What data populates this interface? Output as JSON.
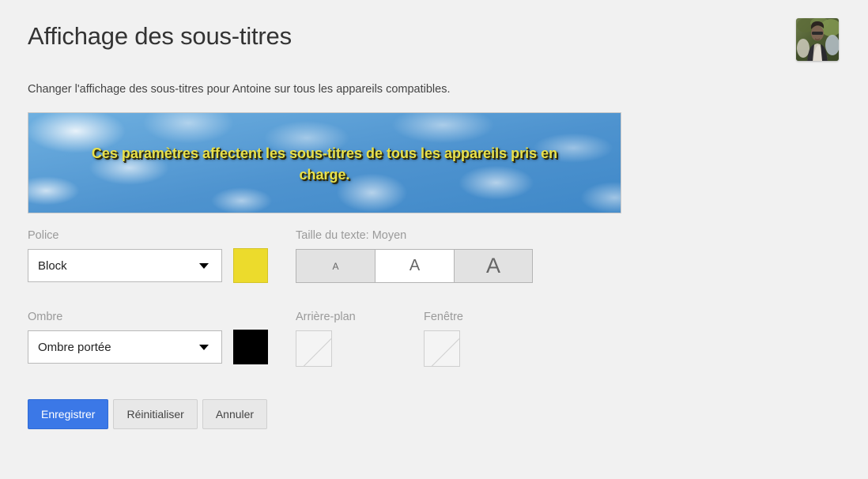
{
  "header": {
    "title": "Affichage des sous-titres",
    "subtitle": "Changer l'affichage des sous-titres pour Antoine sur tous les appareils compatibles.",
    "avatar_alt": "avatar"
  },
  "preview": {
    "caption_text": "Ces paramètres affectent les sous-titres de tous les appareils pris en charge.",
    "text_color": "#e9e14a",
    "shadow_color": "#2a2a12",
    "sky_color": "#5ba0d8"
  },
  "form": {
    "font": {
      "label": "Police",
      "value": "Block",
      "color": "#ecdb2c"
    },
    "text_size": {
      "label": "Taille du texte: Moyen",
      "options": [
        {
          "glyph": "A",
          "size": "small",
          "selected": false
        },
        {
          "glyph": "A",
          "size": "medium",
          "selected": true
        },
        {
          "glyph": "A",
          "size": "large",
          "selected": false
        }
      ]
    },
    "shadow": {
      "label": "Ombre",
      "value": "Ombre portée",
      "color": "#000000"
    },
    "background": {
      "label": "Arrière-plan",
      "color": "transparent"
    },
    "window": {
      "label": "Fenêtre",
      "color": "transparent"
    }
  },
  "actions": {
    "save": "Enregistrer",
    "reset": "Réinitialiser",
    "cancel": "Annuler",
    "primary_color": "#3b78e7"
  }
}
